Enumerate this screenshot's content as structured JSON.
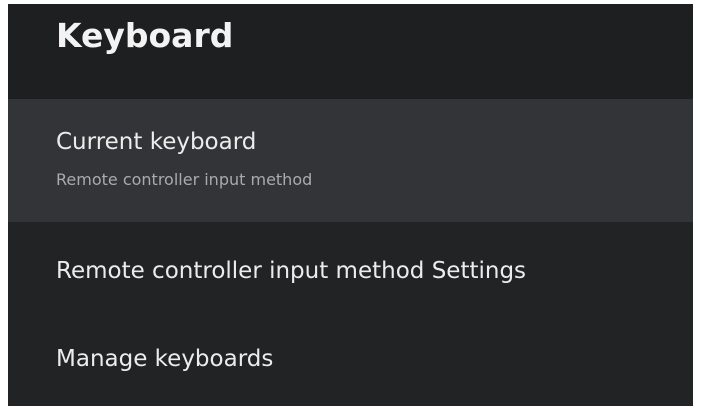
{
  "header": {
    "title": "Keyboard"
  },
  "items": [
    {
      "label": "Current keyboard",
      "sublabel": "Remote controller input method"
    },
    {
      "label": "Remote controller input method Settings"
    },
    {
      "label": "Manage keyboards"
    }
  ],
  "colors": {
    "panel_background": "#222325",
    "header_background": "#1e1f21",
    "focused_item_background": "#333437",
    "primary_text": "#ececec",
    "secondary_text": "#a9aaac"
  }
}
